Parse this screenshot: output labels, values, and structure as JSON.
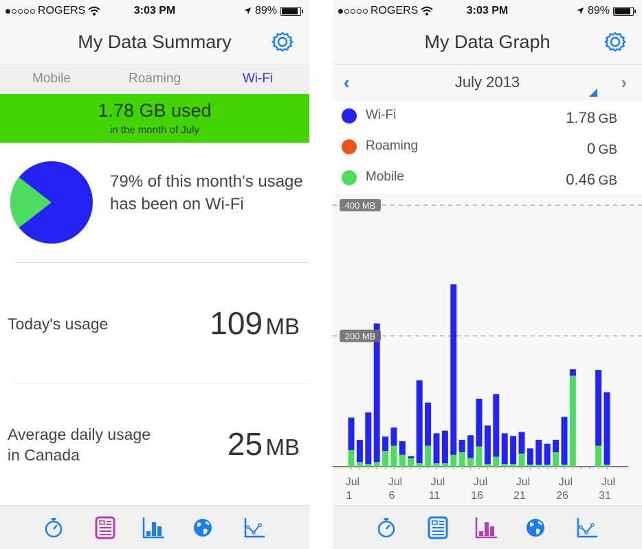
{
  "status_bar": {
    "carrier": "ROGERS",
    "signal_bars_filled": 1,
    "signal_bars_total": 5,
    "time": "3:03 PM",
    "battery": "89%",
    "battery_level": 0.89
  },
  "summary_screen": {
    "title": "My Data Summary",
    "tabs": [
      {
        "label": "Mobile",
        "active": false
      },
      {
        "label": "Roaming",
        "active": false
      },
      {
        "label": "Wi-Fi",
        "active": true
      }
    ],
    "banner": {
      "used": "1.78 GB used",
      "subtitle": "in the month of July",
      "color": "#42d302"
    },
    "pie": {
      "wifi_share": 0.79,
      "mobile_share": 0.21,
      "wifi_color": "#2323f5",
      "mobile_color": "#4cdc60"
    },
    "share_text": "79% of this month's usage has been on Wi-Fi",
    "stats": [
      {
        "label": "Today's usage",
        "value": "109",
        "unit": "MB"
      },
      {
        "label": "Average daily usage in Canada",
        "value": "25",
        "unit": "MB"
      }
    ]
  },
  "graph_screen": {
    "title": "My Data Graph",
    "month": "July 2013",
    "prev_icon": "chevron-left-icon",
    "next_icon": "chevron-right-icon",
    "legend": [
      {
        "label": "Wi-Fi",
        "value": "1.78",
        "unit": "GB",
        "color": "#2323f5"
      },
      {
        "label": "Roaming",
        "value": "0",
        "unit": "GB",
        "color": "#e8561a"
      },
      {
        "label": "Mobile",
        "value": "0.46",
        "unit": "GB",
        "color": "#4cdc60"
      }
    ]
  },
  "tab_bar": {
    "items": [
      {
        "name": "stopwatch-icon",
        "label": "Usage"
      },
      {
        "name": "summary-list-icon",
        "label": "Summary"
      },
      {
        "name": "bar-chart-icon",
        "label": "Graph"
      },
      {
        "name": "globe-icon",
        "label": "Roaming"
      },
      {
        "name": "line-chart-icon",
        "label": "Trend"
      }
    ],
    "left_active_index": 1,
    "right_active_index": 2,
    "active_color": "#b83fb0",
    "inactive_color": "#1a7ef0"
  },
  "chart_data": {
    "type": "bar",
    "stacked": true,
    "title": "July 2013",
    "xlabel": "",
    "ylabel": "MB",
    "ylim": [
      0,
      400
    ],
    "yticks": [
      {
        "value": 200,
        "label": "200 MB"
      },
      {
        "value": 400,
        "label": "400 MB"
      }
    ],
    "grid": true,
    "x": [
      1,
      2,
      3,
      4,
      5,
      6,
      7,
      8,
      9,
      10,
      11,
      12,
      13,
      14,
      15,
      16,
      17,
      18,
      19,
      20,
      21,
      22,
      23,
      24,
      25,
      26,
      27,
      28,
      29,
      30,
      31
    ],
    "xtick_labels": [
      {
        "day": 1,
        "label": "Jul 1"
      },
      {
        "day": 6,
        "label": "Jul 6"
      },
      {
        "day": 11,
        "label": "Jul 11"
      },
      {
        "day": 16,
        "label": "Jul 16"
      },
      {
        "day": 21,
        "label": "Jul 21"
      },
      {
        "day": 26,
        "label": "Jul 26"
      },
      {
        "day": 31,
        "label": "Jul 31"
      }
    ],
    "series": [
      {
        "name": "Mobile",
        "color": "#4cdc60",
        "values": [
          25,
          7,
          4,
          7,
          24,
          32,
          18,
          13,
          5,
          32,
          5,
          5,
          18,
          22,
          13,
          31,
          4,
          15,
          4,
          4,
          20,
          3,
          3,
          3,
          22,
          3,
          139,
          0,
          0,
          32,
          3
        ]
      },
      {
        "name": "Wi-Fi",
        "color": "#2323f5",
        "values": [
          50,
          34,
          79,
          212,
          22,
          28,
          21,
          3,
          127,
          66,
          46,
          50,
          261,
          19,
          35,
          73,
          59,
          96,
          47,
          43,
          33,
          25,
          38,
          32,
          19,
          73,
          10,
          0,
          0,
          116,
          111
        ]
      }
    ]
  }
}
